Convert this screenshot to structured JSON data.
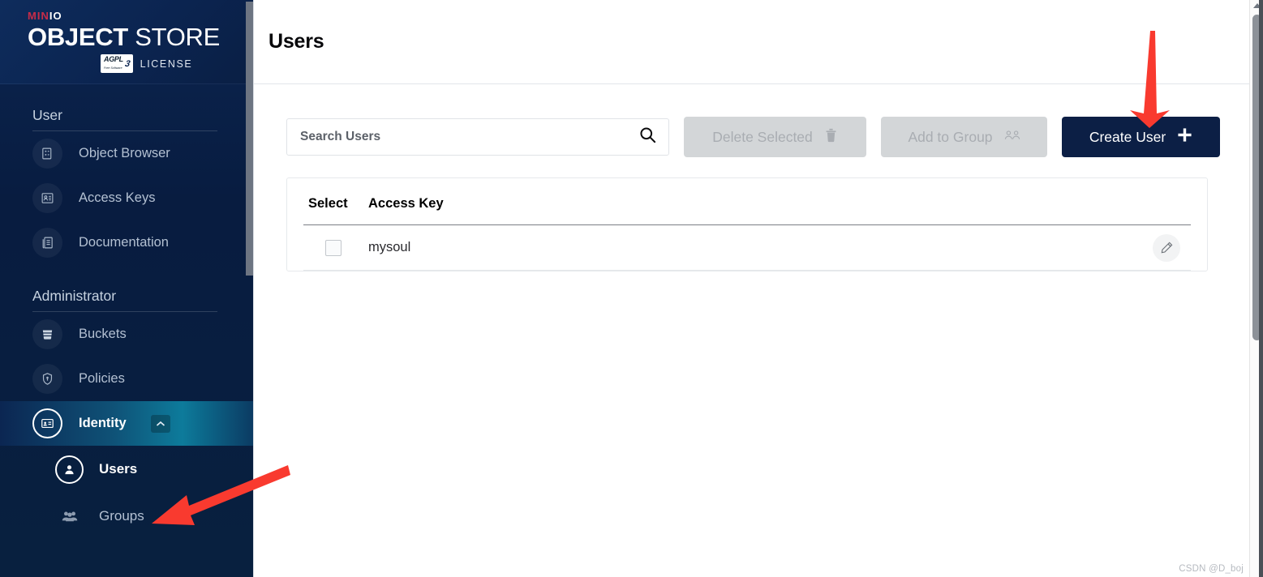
{
  "brand": {
    "minio_first": "MIN",
    "minio_second": "IO",
    "object": "OBJECT",
    "store": "STORE",
    "agpl": "AGPL",
    "agpl_sub": "Free Software",
    "agpl_version": "3",
    "license": "LICENSE"
  },
  "sidebar": {
    "sections": [
      {
        "title": "User",
        "items": [
          {
            "label": "Object Browser",
            "icon": "object-browser-icon",
            "state": "normal"
          },
          {
            "label": "Access Keys",
            "icon": "access-keys-icon",
            "state": "normal"
          },
          {
            "label": "Documentation",
            "icon": "documentation-icon",
            "state": "normal"
          }
        ]
      },
      {
        "title": "Administrator",
        "items": [
          {
            "label": "Buckets",
            "icon": "buckets-icon",
            "state": "normal"
          },
          {
            "label": "Policies",
            "icon": "policies-shield-icon",
            "state": "normal"
          },
          {
            "label": "Identity",
            "icon": "identity-card-icon",
            "state": "active",
            "chevron": "chevron-up-icon"
          }
        ],
        "subitems": [
          {
            "label": "Users",
            "icon": "user-person-icon",
            "state": "selected"
          },
          {
            "label": "Groups",
            "icon": "groups-people-icon",
            "state": "normal"
          }
        ]
      }
    ]
  },
  "header": {
    "title": "Users"
  },
  "toolbar": {
    "search_placeholder": "Search Users",
    "search_value": "",
    "search_icon": "search-icon",
    "delete_label": "Delete Selected",
    "delete_icon": "trash-icon",
    "delete_disabled": true,
    "addgroup_label": "Add to Group",
    "addgroup_icon": "group-icon",
    "addgroup_disabled": true,
    "create_label": "Create User",
    "create_icon": "plus-icon"
  },
  "table": {
    "columns": [
      "Select",
      "Access Key"
    ],
    "rows": [
      {
        "selected": false,
        "access_key": "mysoul",
        "action_icon": "edit-pencil-icon"
      }
    ]
  },
  "annotations": {
    "arrow_color": "#f93a2f",
    "arrow_top_target": "create-user-button",
    "arrow_left_target": "sidebar-item-users"
  },
  "watermark": {
    "text": "CSDN @D_boj"
  },
  "colors": {
    "sidebar_dark": "#081c40",
    "active_teal": "#0d7b9b",
    "primary_button": "#0c1f45",
    "minio_red": "#c72c48",
    "disabled_grey": "#d3d6d8"
  }
}
